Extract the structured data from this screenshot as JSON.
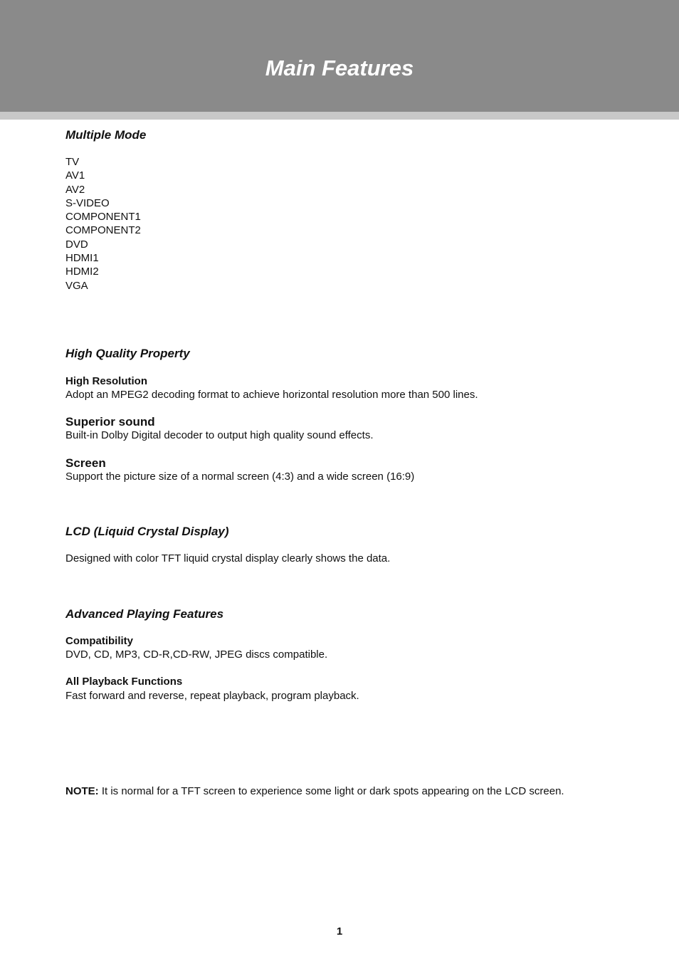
{
  "header": {
    "title": "Main Features",
    "band_color": "#8a8a8a",
    "strip_color": "#c8c8c8"
  },
  "sections": {
    "multiple_mode": {
      "title": "Multiple Mode",
      "modes": [
        "TV",
        "AV1",
        "AV2",
        "S-VIDEO",
        "COMPONENT1",
        "COMPONENT2",
        "DVD",
        "HDMI1",
        "HDMI2",
        "VGA"
      ]
    },
    "high_quality": {
      "title": "High Quality Property",
      "items": [
        {
          "heading": "High Resolution",
          "text": "Adopt an MPEG2 decoding format to achieve horizontal resolution more than 500 lines."
        },
        {
          "heading": "Superior sound",
          "text": "Built-in Dolby Digital decoder to output high quality sound effects."
        },
        {
          "heading": "Screen",
          "text": "Support the picture size of a normal screen (4:3) and a wide screen (16:9)"
        }
      ]
    },
    "lcd": {
      "title": "LCD (Liquid Crystal Display)",
      "text": "Designed with color TFT liquid crystal display clearly shows the data."
    },
    "advanced": {
      "title": "Advanced Playing Features",
      "items": [
        {
          "heading": "Compatibility",
          "text": "DVD, CD, MP3, CD-R,CD-RW, JPEG discs compatible."
        },
        {
          "heading": "All Playback Functions",
          "text": "Fast forward and reverse, repeat playback, program playback."
        }
      ]
    }
  },
  "note": {
    "label": "NOTE:",
    "text": " It is normal for a TFT screen to experience some light or dark spots appearing on the LCD screen."
  },
  "footer": {
    "page_number": "1"
  }
}
